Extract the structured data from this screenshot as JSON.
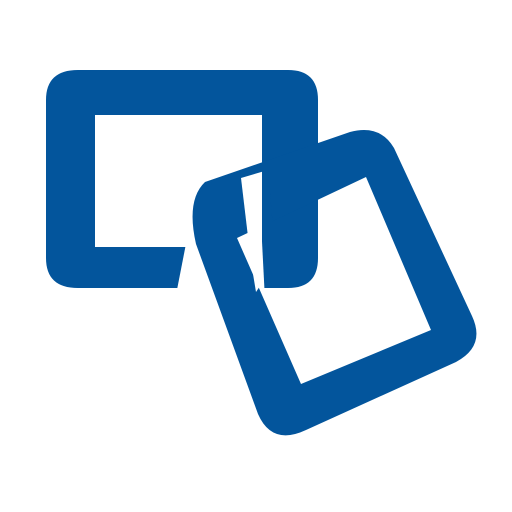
{
  "icon": {
    "name": "link-icon",
    "colors": {
      "primary": "#03559C",
      "background": "#FFFFFF"
    }
  }
}
